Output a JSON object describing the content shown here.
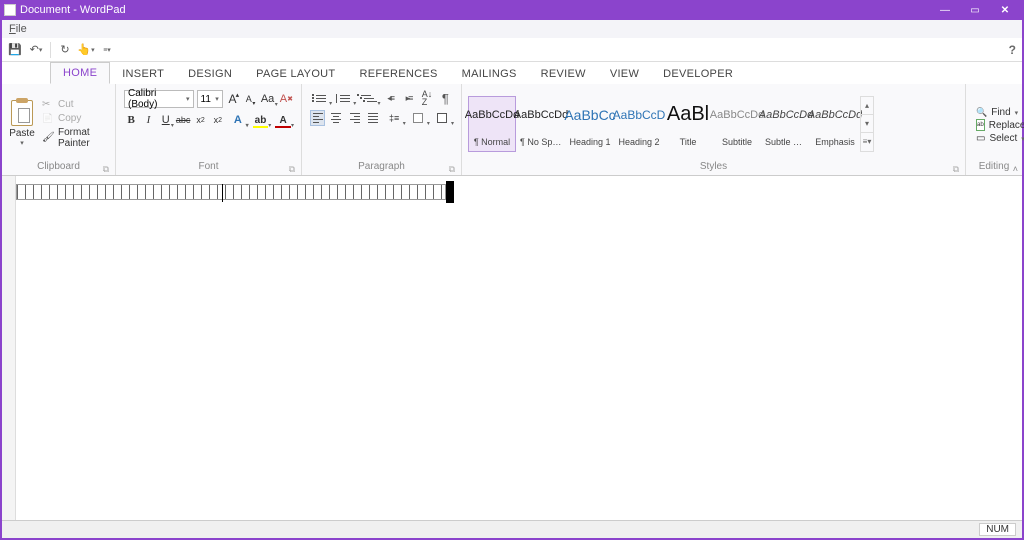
{
  "window": {
    "title": "Document - WordPad"
  },
  "menubar": {
    "file": "File"
  },
  "qat": {
    "save": "save",
    "undo": "undo",
    "redo": "redo",
    "touch": "touch",
    "customize": "customize"
  },
  "tabs": [
    "HOME",
    "INSERT",
    "DESIGN",
    "PAGE LAYOUT",
    "REFERENCES",
    "MAILINGS",
    "REVIEW",
    "VIEW",
    "DEVELOPER"
  ],
  "active_tab": "HOME",
  "clipboard": {
    "group": "Clipboard",
    "paste": "Paste",
    "cut": "Cut",
    "copy": "Copy",
    "format_painter": "Format Painter"
  },
  "font": {
    "group": "Font",
    "name": "Calibri (Body)",
    "size": "11",
    "grow": "A",
    "shrink": "A",
    "case": "Aa",
    "clear": "A"
  },
  "paragraph": {
    "group": "Paragraph"
  },
  "styles": {
    "group": "Styles",
    "items": [
      {
        "preview": "AaBbCcDd",
        "name": "¶ Normal",
        "cls": "norm"
      },
      {
        "preview": "AaBbCcDd",
        "name": "¶ No Spac...",
        "cls": "nosp"
      },
      {
        "preview": "AaBbCc",
        "name": "Heading 1",
        "cls": "h1"
      },
      {
        "preview": "AaBbCcD",
        "name": "Heading 2",
        "cls": "h2"
      },
      {
        "preview": "AaBl",
        "name": "Title",
        "cls": "title"
      },
      {
        "preview": "AaBbCcDd",
        "name": "Subtitle",
        "cls": "sub"
      },
      {
        "preview": "AaBbCcDd",
        "name": "Subtle Em...",
        "cls": "se"
      },
      {
        "preview": "AaBbCcDd",
        "name": "Emphasis",
        "cls": "em"
      }
    ]
  },
  "editing": {
    "group": "Editing",
    "find": "Find",
    "replace": "Replace",
    "select": "Select"
  },
  "statusbar": {
    "num": "NUM"
  },
  "colors": {
    "accent": "#8b44cc",
    "font_color": "#c00000",
    "highlight": "#ffff00"
  }
}
